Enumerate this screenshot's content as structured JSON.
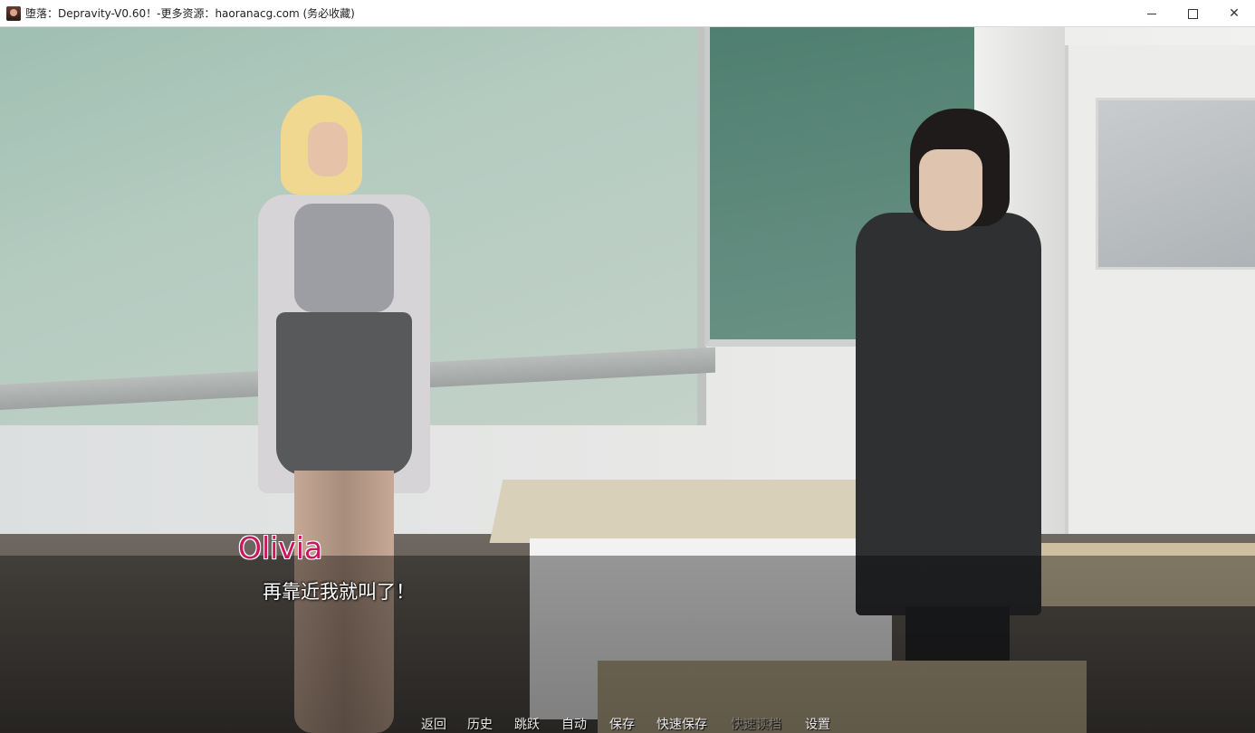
{
  "window": {
    "title": "堕落：Depravity-V0.60！-更多资源：haoranacg.com (务必收藏)",
    "minimize_glyph": "",
    "maximize_glyph": "",
    "close_glyph": "✕"
  },
  "dialogue": {
    "speaker": "Olivia",
    "text": "再靠近我就叫了！",
    "speaker_color": "#c8185f"
  },
  "quick_menu": {
    "back": "返回",
    "history": "历史",
    "skip": "跳跃",
    "auto": "自动",
    "save": "保存",
    "quick_save": "快速保存",
    "quick_load": "快速读档",
    "settings": "设置"
  }
}
